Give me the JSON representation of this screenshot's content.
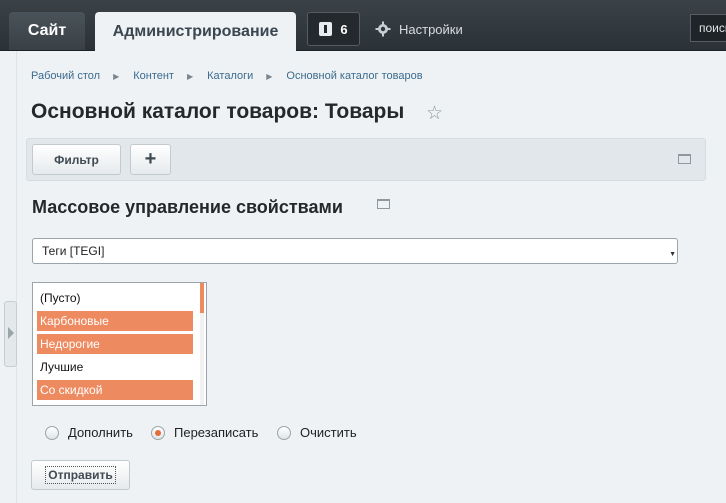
{
  "topbar": {
    "tab_site": "Сайт",
    "tab_admin": "Администрирование",
    "notifications_count": "6",
    "settings_label": "Настройки",
    "search_placeholder": "поиск"
  },
  "breadcrumb": [
    "Рабочий стол",
    "Контент",
    "Каталоги",
    "Основной каталог товаров"
  ],
  "page_title": "Основной каталог товаров: Товары",
  "filter_bar": {
    "filter_label": "Фильтр",
    "add_label": "+"
  },
  "section_title": "Массовое управление свойствами",
  "property_select": {
    "selected": "Теги [TEGI]"
  },
  "values_list": [
    {
      "label": "(Пусто)",
      "selected": false
    },
    {
      "label": "Карбоновые",
      "selected": true
    },
    {
      "label": "Недорогие",
      "selected": true
    },
    {
      "label": "Лучшие",
      "selected": false
    },
    {
      "label": "Со скидкой",
      "selected": true
    }
  ],
  "mode_options": [
    {
      "label": "Дополнить",
      "checked": false
    },
    {
      "label": "Перезаписать",
      "checked": true
    },
    {
      "label": "Очистить",
      "checked": false
    }
  ],
  "submit_label": "Отправить",
  "colors": {
    "topbar": "#2f363b",
    "accent_selection": "#ee8a60",
    "link": "#3c6b8f",
    "background": "#eef2f4"
  }
}
